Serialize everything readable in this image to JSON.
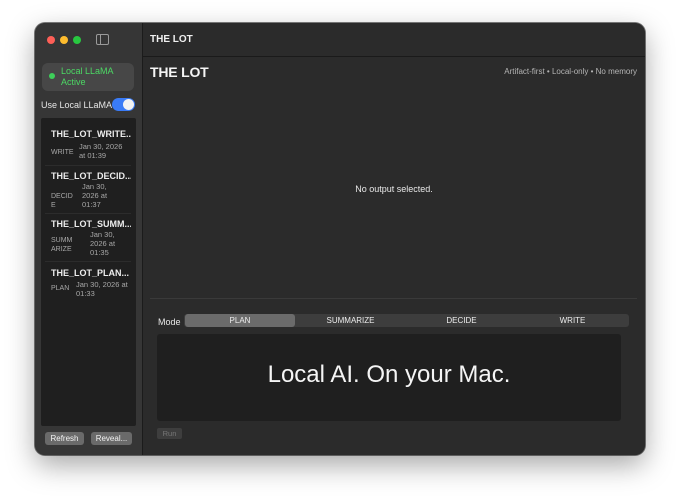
{
  "window_title": "THE LOT",
  "sidebar": {
    "status_text": "Local LLaMA Active",
    "toggle_label": "Use Local LLaMA",
    "toggle_on": true,
    "items": [
      {
        "title": "THE_LOT_WRITE...",
        "mode": "WRITE",
        "date": "Jan 30, 2026 at 01:39"
      },
      {
        "title": "THE_LOT_DECID...",
        "mode": "DECIDE",
        "date": "Jan 30, 2026 at 01:37"
      },
      {
        "title": "THE_LOT_SUMM...",
        "mode": "SUMMARIZE",
        "date": "Jan 30, 2026 at 01:35"
      },
      {
        "title": "THE_LOT_PLAN...",
        "mode": "PLAN",
        "date": "Jan 30, 2026 at 01:33"
      }
    ],
    "refresh_label": "Refresh",
    "reveal_label": "Reveal..."
  },
  "main": {
    "brand": "THE LOT",
    "tagline": "Artifact-first • Local-only • No memory",
    "empty_message": "No output selected.",
    "mode_label": "Mode",
    "modes": [
      "PLAN",
      "SUMMARIZE",
      "DECIDE",
      "WRITE"
    ],
    "selected_mode": "PLAN",
    "output_text": "Local AI. On your Mac.",
    "run_label": "Run"
  },
  "colors": {
    "status_green": "#4cd964",
    "toggle_blue": "#3a7bf6",
    "window_bg": "#2b2b2b",
    "sidebar_bg": "#363636"
  }
}
